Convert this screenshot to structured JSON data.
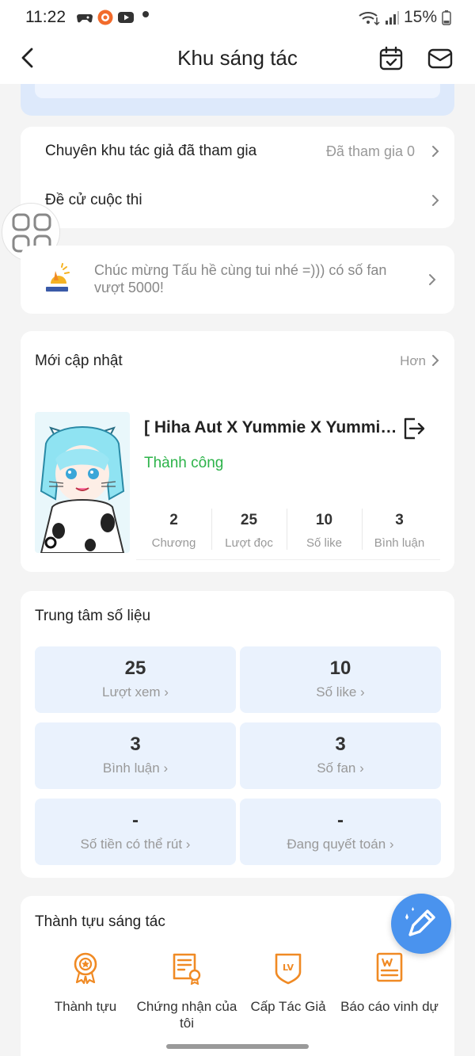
{
  "status_bar": {
    "time": "11:22",
    "battery": "15%"
  },
  "header": {
    "title": "Khu sáng tác"
  },
  "menu": {
    "joined_label": "Chuyên khu tác giả đã tham gia",
    "joined_value": "Đã tham gia 0",
    "nominate_label": "Đề cử cuộc thi"
  },
  "notice": {
    "text": "Chúc mừng Tấu hề cùng tui nhé =))) có số fan vượt 5000!"
  },
  "updates": {
    "title": "Mới cập nhật",
    "more": "Hơn",
    "story": {
      "title": "[ Hiha Aut X Yummie X Yummie...",
      "status": "Thành công",
      "stats": [
        {
          "value": "2",
          "label": "Chương"
        },
        {
          "value": "25",
          "label": "Lượt đọc"
        },
        {
          "value": "10",
          "label": "Số like"
        },
        {
          "value": "3",
          "label": "Bình luận"
        }
      ]
    }
  },
  "data_center": {
    "title": "Trung tâm số liệu",
    "tiles": [
      {
        "value": "25",
        "label": "Lượt xem"
      },
      {
        "value": "10",
        "label": "Số like"
      },
      {
        "value": "3",
        "label": "Bình luận"
      },
      {
        "value": "3",
        "label": "Số fan"
      },
      {
        "value": "-",
        "label": "Số tiền có thể rút"
      },
      {
        "value": "-",
        "label": "Đang quyết toán"
      }
    ]
  },
  "achievements": {
    "title": "Thành tựu sáng tác",
    "items": [
      {
        "label": "Thành tựu",
        "icon": "medal-icon"
      },
      {
        "label": "Chứng nhận của tôi",
        "icon": "certificate-icon"
      },
      {
        "label": "Cấp Tác Giả",
        "icon": "level-badge-icon"
      },
      {
        "label": "Báo cáo vinh dự",
        "icon": "honor-report-icon"
      }
    ]
  },
  "colors": {
    "accent_orange": "#f08a24",
    "success_green": "#2db34a",
    "tile_bg": "#eaf2fd",
    "fab_blue": "#4a93ee"
  }
}
